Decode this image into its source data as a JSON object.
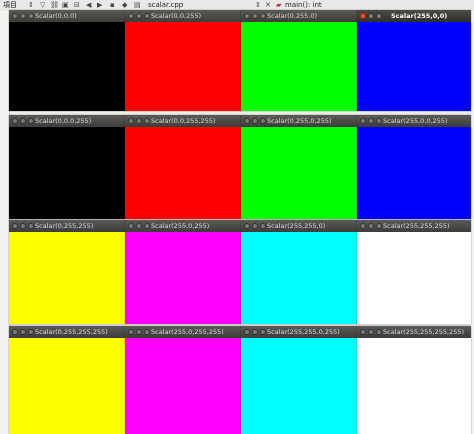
{
  "topbar": {
    "project_label": "項目",
    "file_name": "scalar.cpp",
    "function_name": "main(): int"
  },
  "windows": [
    {
      "title": "Scalar(0,0,0)",
      "color": "#000000"
    },
    {
      "title": "Scalar(0,0,255)",
      "color": "#ff0000"
    },
    {
      "title": "Scalar(0,255,0)",
      "color": "#00ff00"
    },
    {
      "title": "Scalar(255,0,0)",
      "color": "#0000ff"
    },
    {
      "title": "Scalar(0,0,0,255)",
      "color": "#000000"
    },
    {
      "title": "Scalar(0,0,255,255)",
      "color": "#ff0000"
    },
    {
      "title": "Scalar(0,255,0,255)",
      "color": "#00ff00"
    },
    {
      "title": "Scalar(255,0,0,255)",
      "color": "#0000ff"
    },
    {
      "title": "Scalar(0,255,255)",
      "color": "#ffff00"
    },
    {
      "title": "Scalar(255,0,255)",
      "color": "#ff00ff"
    },
    {
      "title": "Scalar(255,255,0)",
      "color": "#00ffff"
    },
    {
      "title": "Scalar(255,255,255)",
      "color": "#ffffff"
    },
    {
      "title": "Scalar(0,255,255,255)",
      "color": "#ffff00"
    },
    {
      "title": "Scalar(255,0,255,255)",
      "color": "#ff00ff"
    },
    {
      "title": "Scalar(255,255,0,255)",
      "color": "#00ffff"
    },
    {
      "title": "Scalar(255,255,255,255)",
      "color": "#ffffff"
    }
  ]
}
